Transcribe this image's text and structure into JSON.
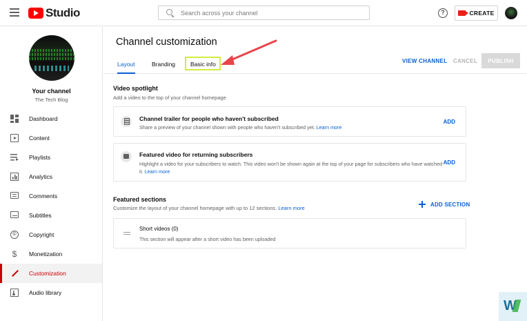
{
  "header": {
    "logo_text": "Studio",
    "search_placeholder": "Search across your channel",
    "help_icon": "?",
    "create_label": "CREATE"
  },
  "sidebar": {
    "channel_title": "Your channel",
    "channel_name": "The Tech Blog",
    "items": [
      {
        "label": "Dashboard",
        "icon": "dashboard-icon"
      },
      {
        "label": "Content",
        "icon": "content-icon"
      },
      {
        "label": "Playlists",
        "icon": "playlists-icon"
      },
      {
        "label": "Analytics",
        "icon": "analytics-icon"
      },
      {
        "label": "Comments",
        "icon": "comments-icon"
      },
      {
        "label": "Subtitles",
        "icon": "subtitles-icon"
      },
      {
        "label": "Copyright",
        "icon": "copyright-icon"
      },
      {
        "label": "Monetization",
        "icon": "monetization-icon"
      },
      {
        "label": "Customization",
        "icon": "customization-icon",
        "active": true
      },
      {
        "label": "Audio library",
        "icon": "audio-library-icon"
      }
    ],
    "copyright_glyph": "©",
    "money_glyph": "$"
  },
  "main": {
    "title": "Channel customization",
    "tabs": [
      {
        "label": "Layout",
        "active": true
      },
      {
        "label": "Branding"
      },
      {
        "label": "Basic info",
        "highlighted": true
      }
    ],
    "actions": {
      "view_channel": "VIEW CHANNEL",
      "cancel": "CANCEL",
      "publish": "PUBLISH"
    },
    "video_spotlight": {
      "title": "Video spotlight",
      "description": "Add a video to the top of your channel homepage",
      "cards": [
        {
          "title": "Channel trailer for people who haven't subscribed",
          "description": "Share a preview of your channel shown with people who haven't subscribed yet.",
          "learn_more": "Learn more",
          "action": "ADD"
        },
        {
          "title": "Featured video for returning subscribers",
          "description": "Highlight a video for your subscribers to watch. This video won't be shown again at the top of your page for subscribers who have watched it.",
          "learn_more": "Learn more",
          "action": "ADD"
        }
      ]
    },
    "featured_sections": {
      "title": "Featured sections",
      "description": "Customize the layout of your channel homepage with up to 12 sections.",
      "learn_more": "Learn more",
      "add_section": "ADD SECTION",
      "items": [
        {
          "title": "Short videos (0)",
          "description": "This section will appear after a short video has been uploaded"
        }
      ]
    }
  },
  "colors": {
    "accent_blue": "#065fd4",
    "active_red": "#cc0000",
    "highlight": "#d4ec3c",
    "annotation_arrow": "#e8454b"
  }
}
